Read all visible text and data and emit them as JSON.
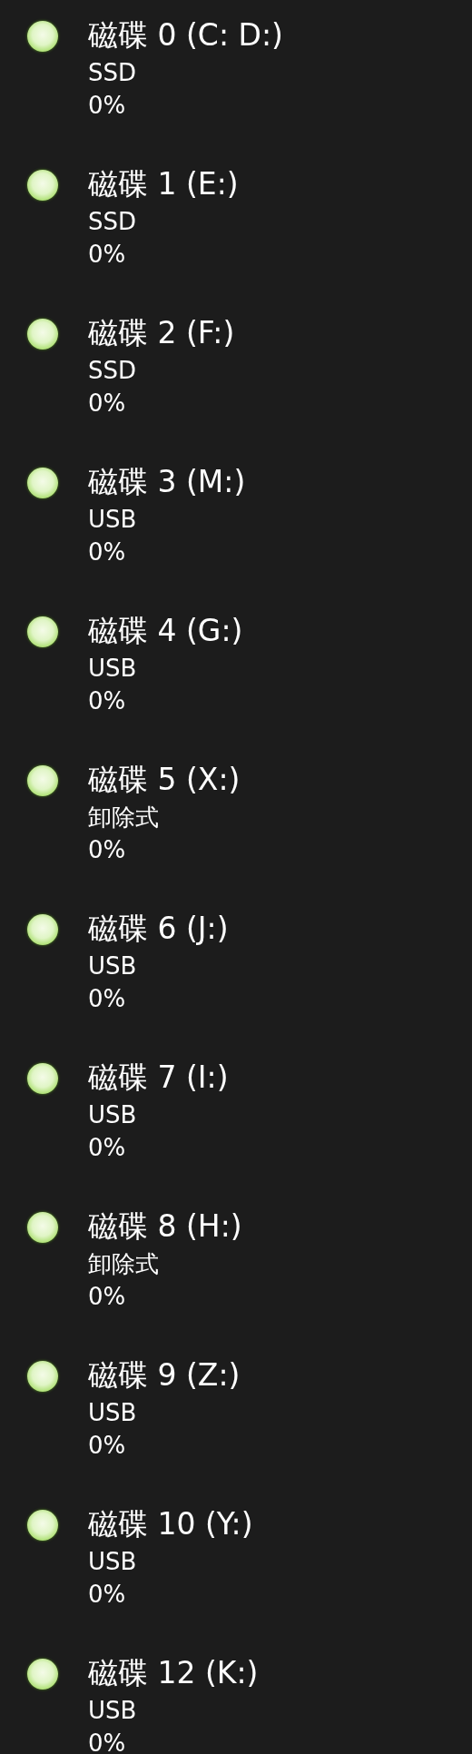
{
  "disks": [
    {
      "title": "磁碟 0 (C: D:)",
      "type": "SSD",
      "usage": "0%"
    },
    {
      "title": "磁碟 1 (E:)",
      "type": "SSD",
      "usage": "0%"
    },
    {
      "title": "磁碟 2 (F:)",
      "type": "SSD",
      "usage": "0%"
    },
    {
      "title": "磁碟 3 (M:)",
      "type": "USB",
      "usage": "0%"
    },
    {
      "title": "磁碟 4 (G:)",
      "type": "USB",
      "usage": "0%"
    },
    {
      "title": "磁碟 5 (X:)",
      "type": "卸除式",
      "usage": "0%"
    },
    {
      "title": "磁碟 6 (J:)",
      "type": "USB",
      "usage": "0%"
    },
    {
      "title": "磁碟 7 (I:)",
      "type": "USB",
      "usage": "0%"
    },
    {
      "title": "磁碟 8 (H:)",
      "type": "卸除式",
      "usage": "0%"
    },
    {
      "title": "磁碟 9 (Z:)",
      "type": "USB",
      "usage": "0%"
    },
    {
      "title": "磁碟 10 (Y:)",
      "type": "USB",
      "usage": "0%"
    },
    {
      "title": "磁碟 12 (K:)",
      "type": "USB",
      "usage": "0%"
    }
  ]
}
